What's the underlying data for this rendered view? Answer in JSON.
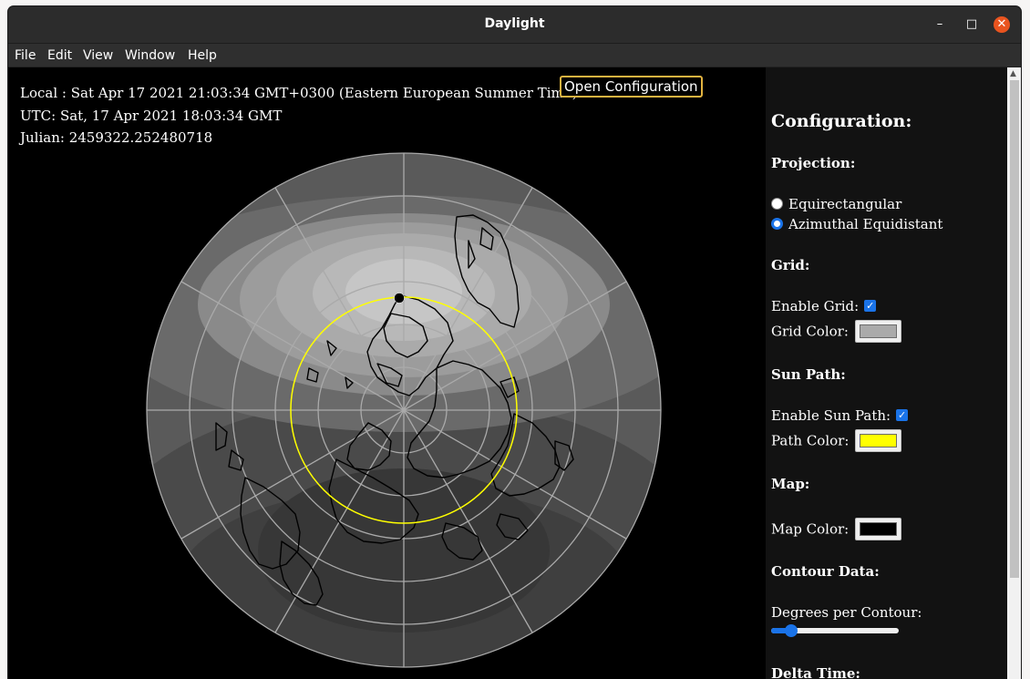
{
  "window": {
    "title": "Daylight",
    "minimize_icon": "–",
    "maximize_icon": "□",
    "close_icon": "✕"
  },
  "menubar": {
    "items": [
      "File",
      "Edit",
      "View",
      "Window",
      "Help"
    ]
  },
  "info": {
    "local": "Local : Sat Apr 17 2021 21:03:34 GMT+0300 (Eastern European Summer Time)",
    "utc": "UTC: Sat, 17 Apr 2021 18:03:34 GMT",
    "julian": "Julian: 2459322.252480718"
  },
  "open_config_label": "Open Configuration",
  "map_view": {
    "projection": "Azimuthal Equidistant",
    "grid_color": "#aaaaaa",
    "sun_path_color": "#ffff00",
    "map_color": "#000000"
  },
  "config": {
    "title": "Configuration:",
    "projection": {
      "heading": "Projection:",
      "options": [
        {
          "label": "Equirectangular",
          "selected": false
        },
        {
          "label": "Azimuthal Equidistant",
          "selected": true
        }
      ]
    },
    "grid": {
      "heading": "Grid:",
      "enable_label": "Enable Grid:",
      "enabled": true,
      "color_label": "Grid Color:",
      "color": "#aaaaaa"
    },
    "sun_path": {
      "heading": "Sun Path:",
      "enable_label": "Enable Sun Path:",
      "enabled": true,
      "color_label": "Path Color:",
      "color": "#ffff00"
    },
    "map": {
      "heading": "Map:",
      "color_label": "Map Color:",
      "color": "#000000"
    },
    "contour": {
      "heading": "Contour Data:",
      "degrees_label": "Degrees per Contour:"
    },
    "delta_time": {
      "heading": "Delta Time:"
    }
  },
  "scrollbar": {
    "up_icon": "▲"
  }
}
